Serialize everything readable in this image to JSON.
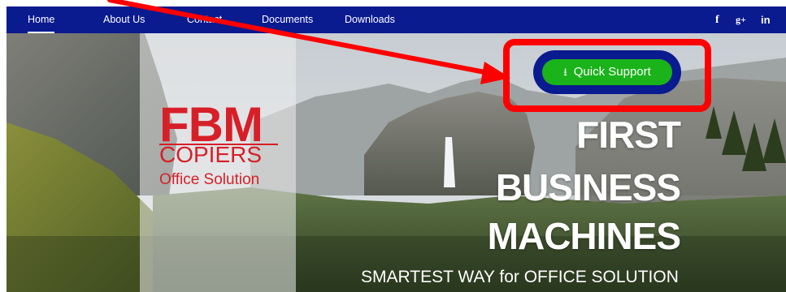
{
  "nav": {
    "items": [
      {
        "label": "Home"
      },
      {
        "label": "About Us"
      },
      {
        "label": "Contact"
      },
      {
        "label": "Documents"
      },
      {
        "label": "Downloads"
      }
    ],
    "active": "Home",
    "social": {
      "facebook": "f",
      "googleplus": "g+",
      "linkedin": "in"
    }
  },
  "logo": {
    "brand": "FBM",
    "line2": "COPIERS",
    "line3": "Office Solution"
  },
  "hero": {
    "title_lines": [
      "FIRST",
      "BUSINESS",
      "MACHINES"
    ],
    "tagline": "SMARTEST WAY for OFFICE SOLUTION"
  },
  "support": {
    "label": "Quick Support",
    "icon": "download-icon"
  },
  "colors": {
    "nav_bg": "#0a1a8f",
    "brand_red": "#d71f28",
    "support_green": "#1ab31a",
    "annotation_red": "#ff0000"
  }
}
